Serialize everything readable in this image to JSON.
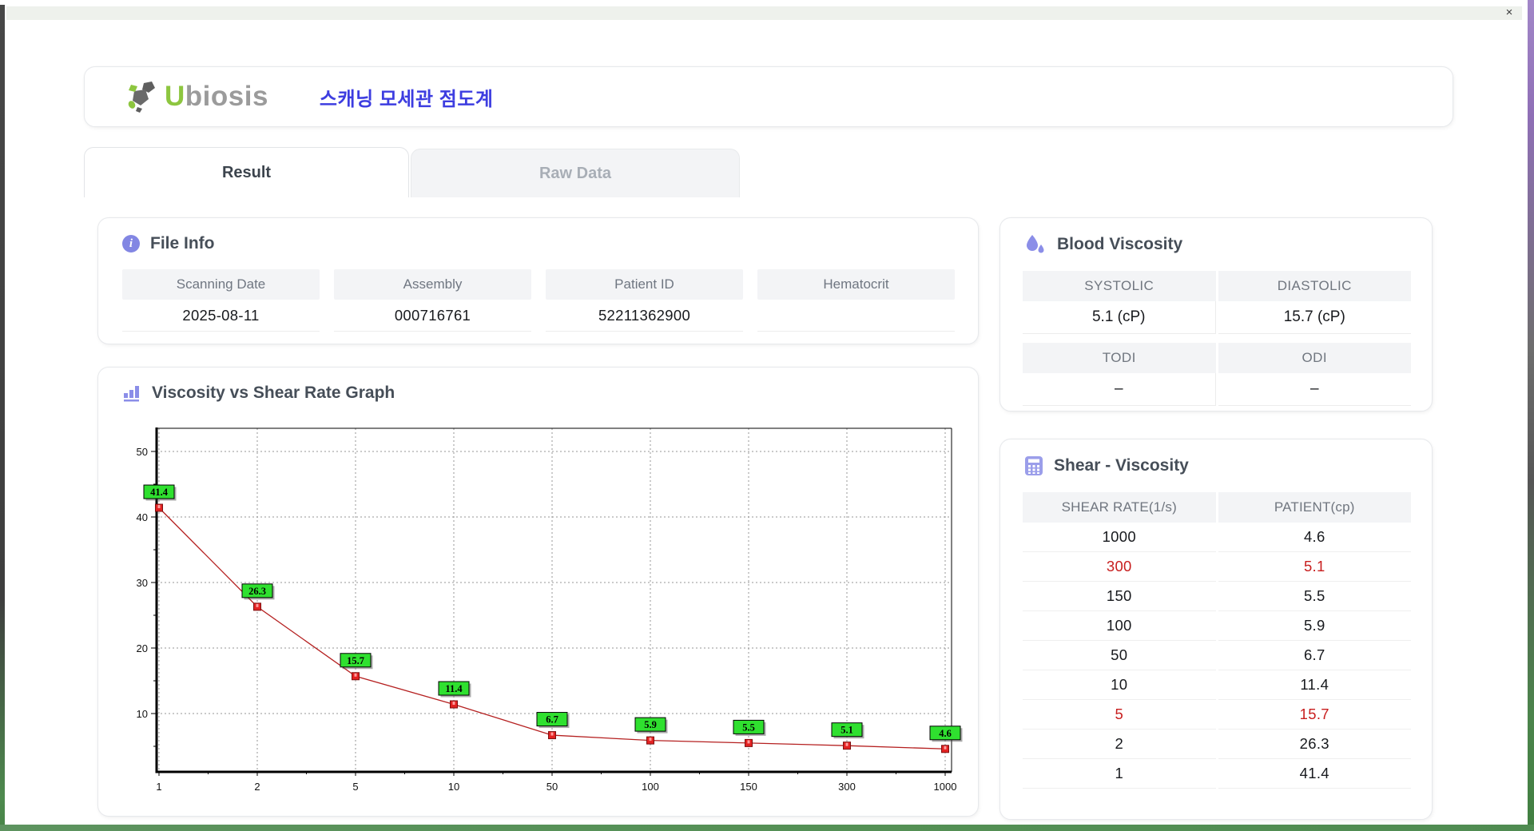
{
  "window": {
    "close_label": "×"
  },
  "header": {
    "logo_u": "U",
    "logo_rest": "biosis",
    "title": "스캐닝 모세관 점도계"
  },
  "tabs": [
    {
      "label": "Result",
      "active": true
    },
    {
      "label": "Raw Data",
      "active": false
    }
  ],
  "file_info": {
    "title": "File Info",
    "fields": [
      {
        "label": "Scanning Date",
        "value": "2025-08-11"
      },
      {
        "label": "Assembly",
        "value": "000716761"
      },
      {
        "label": "Patient ID",
        "value": "52211362900"
      },
      {
        "label": "Hematocrit",
        "value": ""
      }
    ]
  },
  "blood_viscosity": {
    "title": "Blood Viscosity",
    "pairs": [
      [
        {
          "label": "SYSTOLIC",
          "value": "5.1 (cP)"
        },
        {
          "label": "DIASTOLIC",
          "value": "15.7 (cP)"
        }
      ],
      [
        {
          "label": "TODI",
          "value": "–"
        },
        {
          "label": "ODI",
          "value": "–"
        }
      ]
    ]
  },
  "graph": {
    "title": "Viscosity vs Shear Rate Graph"
  },
  "shear_viscosity": {
    "title": "Shear - Viscosity",
    "columns": [
      "SHEAR RATE(1/s)",
      "PATIENT(cp)"
    ],
    "rows": [
      {
        "shear": "1000",
        "patient": "4.6",
        "red": false
      },
      {
        "shear": "300",
        "patient": "5.1",
        "red": true
      },
      {
        "shear": "150",
        "patient": "5.5",
        "red": false
      },
      {
        "shear": "100",
        "patient": "5.9",
        "red": false
      },
      {
        "shear": "50",
        "patient": "6.7",
        "red": false
      },
      {
        "shear": "10",
        "patient": "11.4",
        "red": false
      },
      {
        "shear": "5",
        "patient": "15.7",
        "red": true
      },
      {
        "shear": "2",
        "patient": "26.3",
        "red": false
      },
      {
        "shear": "1",
        "patient": "41.4",
        "red": false
      }
    ]
  },
  "chart_data": {
    "type": "line",
    "title": "Viscosity vs Shear Rate Graph",
    "x": [
      1,
      2,
      5,
      10,
      50,
      100,
      150,
      300,
      1000
    ],
    "values": [
      41.4,
      26.3,
      15.7,
      11.4,
      6.7,
      5.9,
      5.5,
      5.1,
      4.6
    ],
    "x_axis_type": "categorical",
    "y_ticks": [
      10,
      20,
      30,
      40,
      50
    ],
    "y_minor_ticks": [
      5,
      15,
      25,
      35,
      45
    ],
    "ylim": [
      1,
      53.5
    ],
    "grid": true,
    "xlabel": "",
    "ylabel": "",
    "line_color": "#b52020",
    "marker_color": "#e32222",
    "marker_border": "#7d1010",
    "label_bg": "#2fe02f",
    "label_border": "#000000"
  },
  "colors": {
    "accent_purple": "#8286e3",
    "title_blue": "#3d3de0",
    "logo_green": "#8dc63f",
    "logo_gray": "#9b9b9b",
    "highlight_red": "#c81e1e"
  }
}
